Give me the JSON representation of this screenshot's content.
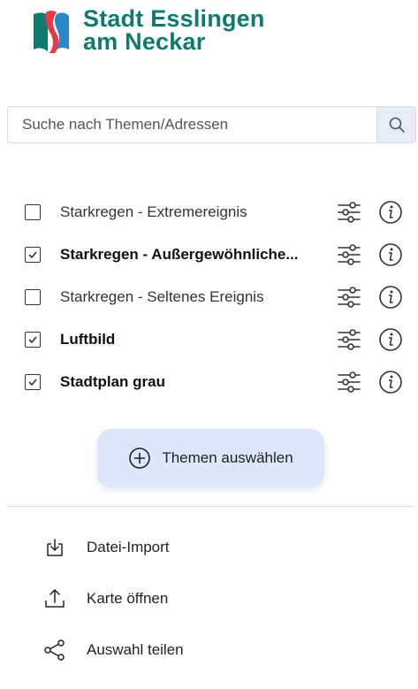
{
  "logo": {
    "line1": "Stadt Esslingen",
    "line2": "am Neckar",
    "colors": {
      "teal": "#0f7a6e",
      "red": "#e63a46",
      "blue": "#2a88c8"
    }
  },
  "search": {
    "placeholder": "Suche nach Themen/Adressen",
    "value": "",
    "icon": "search-icon"
  },
  "layers": [
    {
      "label": "Starkregen - Extremereignis",
      "checked": false,
      "bold": false
    },
    {
      "label": "Starkregen - Außergewöhnliche...",
      "checked": true,
      "bold": true
    },
    {
      "label": "Starkregen - Seltenes Ereignis",
      "checked": false,
      "bold": false
    },
    {
      "label": "Luftbild",
      "checked": true,
      "bold": true
    },
    {
      "label": "Stadtplan grau",
      "checked": true,
      "bold": true
    }
  ],
  "select_button": {
    "label": "Themen auswählen",
    "icon": "plus-circle-icon"
  },
  "menu": [
    {
      "label": "Datei-Import",
      "icon": "file-import-icon"
    },
    {
      "label": "Karte öffnen",
      "icon": "upload-icon"
    },
    {
      "label": "Auswahl teilen",
      "icon": "share-icon"
    }
  ]
}
